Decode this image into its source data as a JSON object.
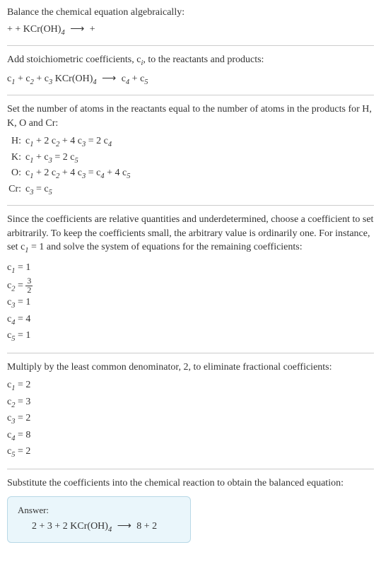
{
  "intro": {
    "line1": "Balance the chemical equation algebraically:",
    "eq_prefix": " + + KCr(OH)",
    "eq_sub": "4",
    "eq_arrow": "⟶",
    "eq_suffix": " + "
  },
  "stoich": {
    "text_before": "Add stoichiometric coefficients, ",
    "ci_c": "c",
    "ci_i": "i",
    "text_after": ", to the reactants and products:",
    "eq_c1": "c",
    "eq_1": "1",
    "eq_plus1": " + ",
    "eq_c2": "c",
    "eq_2": "2",
    "eq_plus2": " + ",
    "eq_c3": "c",
    "eq_3": "3",
    "eq_kcroh": " KCr(OH)",
    "eq_4": "4",
    "eq_arrow": "⟶",
    "eq_c4": "c",
    "eq_4b": "4",
    "eq_plus3": " + ",
    "eq_c5": "c",
    "eq_5": "5"
  },
  "atoms": {
    "intro": "Set the number of atoms in the reactants equal to the number of atoms in the products for H, K, O and Cr:",
    "rows": [
      {
        "label": "H:",
        "c1": "c",
        "s1": "1",
        "t1": " + 2 ",
        "c2": "c",
        "s2": "2",
        "t2": " + 4 ",
        "c3": "c",
        "s3": "3",
        "t3": " = 2 ",
        "c4": "c",
        "s4": "4"
      },
      {
        "label": "K:",
        "c1": "c",
        "s1": "1",
        "t1": " + ",
        "c2": "c",
        "s2": "3",
        "t2": " = 2 ",
        "c3": "c",
        "s3": "5",
        "t3": "",
        "c4": "",
        "s4": ""
      },
      {
        "label": "O:",
        "c1": "c",
        "s1": "1",
        "t1": " + 2 ",
        "c2": "c",
        "s2": "2",
        "t2": " + 4 ",
        "c3": "c",
        "s3": "3",
        "t3": " = ",
        "c4": "c",
        "s4": "4",
        "t4": " + 4 ",
        "c5": "c",
        "s5": "5"
      },
      {
        "label": "Cr:",
        "c1": "c",
        "s1": "3",
        "t1": " = ",
        "c2": "c",
        "s2": "5",
        "t2": "",
        "c3": "",
        "s3": "",
        "t3": "",
        "c4": "",
        "s4": ""
      }
    ]
  },
  "arbitrary": {
    "text_p1": "Since the coefficients are relative quantities and underdetermined, choose a coefficient to set arbitrarily. To keep the coefficients small, the arbitrary value is ordinarily one. For instance, set ",
    "c": "c",
    "s1": "1",
    "text_p2": " = 1 and solve the system of equations for the remaining coefficients:",
    "rows": [
      {
        "c": "c",
        "s": "1",
        "eq": " = 1"
      },
      {
        "c": "c",
        "s": "2",
        "eq": " = ",
        "frac_num": "3",
        "frac_den": "2"
      },
      {
        "c": "c",
        "s": "3",
        "eq": " = 1"
      },
      {
        "c": "c",
        "s": "4",
        "eq": " = 4"
      },
      {
        "c": "c",
        "s": "5",
        "eq": " = 1"
      }
    ]
  },
  "multiply": {
    "text": "Multiply by the least common denominator, 2, to eliminate fractional coefficients:",
    "rows": [
      {
        "c": "c",
        "s": "1",
        "eq": " = 2"
      },
      {
        "c": "c",
        "s": "2",
        "eq": " = 3"
      },
      {
        "c": "c",
        "s": "3",
        "eq": " = 2"
      },
      {
        "c": "c",
        "s": "4",
        "eq": " = 8"
      },
      {
        "c": "c",
        "s": "5",
        "eq": " = 2"
      }
    ]
  },
  "substitute": {
    "text": "Substitute the coefficients into the chemical reaction to obtain the balanced equation:"
  },
  "answer": {
    "label": "Answer:",
    "eq_p1": "2 + 3 + 2 KCr(OH)",
    "eq_sub": "4",
    "eq_arrow": "⟶",
    "eq_p2": "8 + 2"
  }
}
